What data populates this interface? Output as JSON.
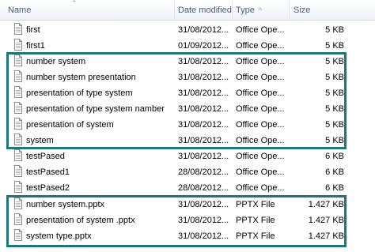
{
  "header": {
    "name": "Name",
    "date": "Date modified",
    "type": "Type",
    "size": "Size"
  },
  "rows": [
    {
      "name": "first",
      "date": "31/08/2012...",
      "type": "Office Ope...",
      "size": "5 KB"
    },
    {
      "name": "first1",
      "date": "01/09/2012...",
      "type": "Office Ope...",
      "size": "5 KB"
    },
    {
      "name": "number system",
      "date": "31/08/2012...",
      "type": "Office Ope...",
      "size": "5 KB"
    },
    {
      "name": "number system presentation",
      "date": "31/08/2012...",
      "type": "Office Ope...",
      "size": "5 KB"
    },
    {
      "name": "presentation of  type system",
      "date": "31/08/2012...",
      "type": "Office Ope...",
      "size": "5 KB"
    },
    {
      "name": "presentation of  type system namber",
      "date": "31/08/2012...",
      "type": "Office Ope...",
      "size": "5 KB"
    },
    {
      "name": "presentation of system",
      "date": "31/08/2012...",
      "type": "Office Ope...",
      "size": "5 KB"
    },
    {
      "name": "system",
      "date": "31/08/2012...",
      "type": "Office Ope...",
      "size": "5 KB"
    },
    {
      "name": "testPased",
      "date": "31/08/2012...",
      "type": "Office Ope...",
      "size": "6 KB"
    },
    {
      "name": "testPased1",
      "date": "28/08/2012...",
      "type": "Office Ope...",
      "size": "6 KB"
    },
    {
      "name": "testPased2",
      "date": "28/08/2012...",
      "type": "Office Ope...",
      "size": "6 KB"
    },
    {
      "name": "number system.pptx",
      "date": "31/08/2012...",
      "type": "PPTX File",
      "size": "1.427 KB"
    },
    {
      "name": "presentation of system .pptx",
      "date": "31/08/2012...",
      "type": "PPTX File",
      "size": "1.427 KB"
    },
    {
      "name": "system type.pptx",
      "date": "31/08/2012...",
      "type": "PPTX File",
      "size": "1.427 KB"
    }
  ],
  "colors": {
    "highlight_box": "#1e7679",
    "header_text": "#4c607a"
  },
  "icons": {
    "file": "document-icon",
    "sort": "sort-ascending-icon",
    "collapse": "chevron-up-icon"
  }
}
